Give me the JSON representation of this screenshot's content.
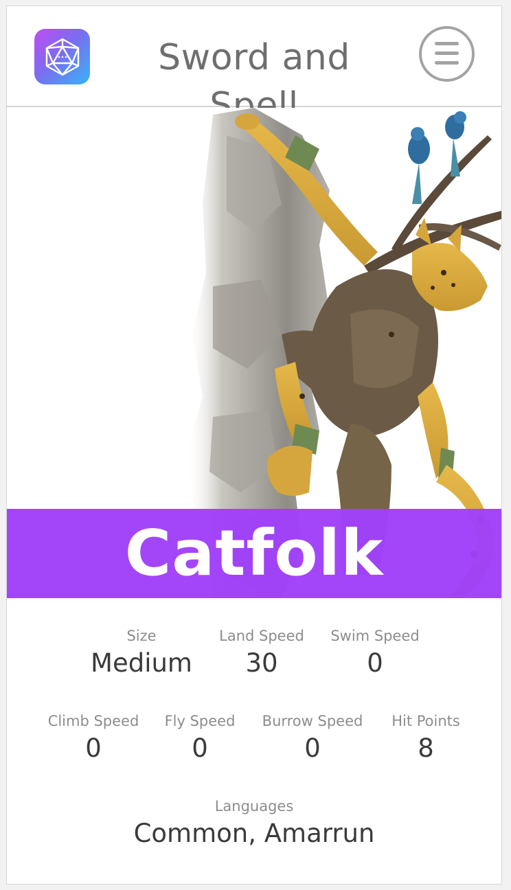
{
  "header": {
    "app_title": "Sword and Spell",
    "logo_icon": "d20-icon",
    "menu_icon": "hamburger-menu-icon"
  },
  "hero": {
    "image": "catfolk-character-illustration",
    "race_name": "Catfolk"
  },
  "stats": {
    "size": {
      "label": "Size",
      "value": "Medium"
    },
    "land_speed": {
      "label": "Land Speed",
      "value": "30"
    },
    "swim_speed": {
      "label": "Swim Speed",
      "value": "0"
    },
    "climb_speed": {
      "label": "Climb Speed",
      "value": "0"
    },
    "fly_speed": {
      "label": "Fly Speed",
      "value": "0"
    },
    "burrow_speed": {
      "label": "Burrow Speed",
      "value": "0"
    },
    "hit_points": {
      "label": "Hit Points",
      "value": "8"
    },
    "languages": {
      "label": "Languages",
      "value": "Common, Amarrun"
    }
  },
  "colors": {
    "accent": "#a040fa",
    "logo_gradient_start": "#c24cf2",
    "logo_gradient_end": "#37b4f5"
  }
}
